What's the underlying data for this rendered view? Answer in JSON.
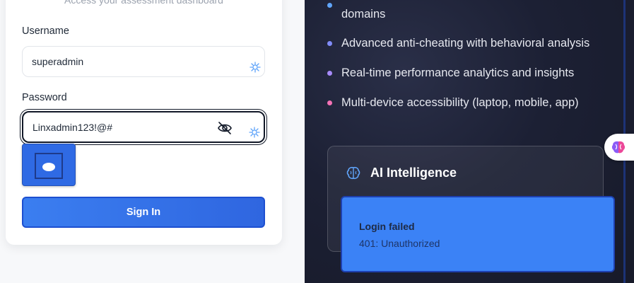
{
  "login": {
    "subtitle": "Access your assessment dashboard",
    "username_label": "Username",
    "username_value": "superadmin",
    "password_label": "Password",
    "password_value": "Linxadmin123!@#",
    "signin_label": "Sign In"
  },
  "features": [
    {
      "label": "domains",
      "dot_color": "#60a5fa"
    },
    {
      "label": "Advanced anti-cheating with behavioral analysis",
      "dot_color": "#818cf8"
    },
    {
      "label": "Real-time performance analytics and insights",
      "dot_color": "#a78bfa"
    },
    {
      "label": "Multi-device accessibility (laptop, mobile, app)",
      "dot_color": "#f472b6"
    }
  ],
  "ai_card": {
    "title": "AI Intelligence",
    "icon": "brain-icon"
  },
  "toast": {
    "title": "Login failed",
    "message": "401: Unauthorized"
  },
  "colors": {
    "accent": "#3b82f6",
    "panel_bg": "#1c2034"
  }
}
